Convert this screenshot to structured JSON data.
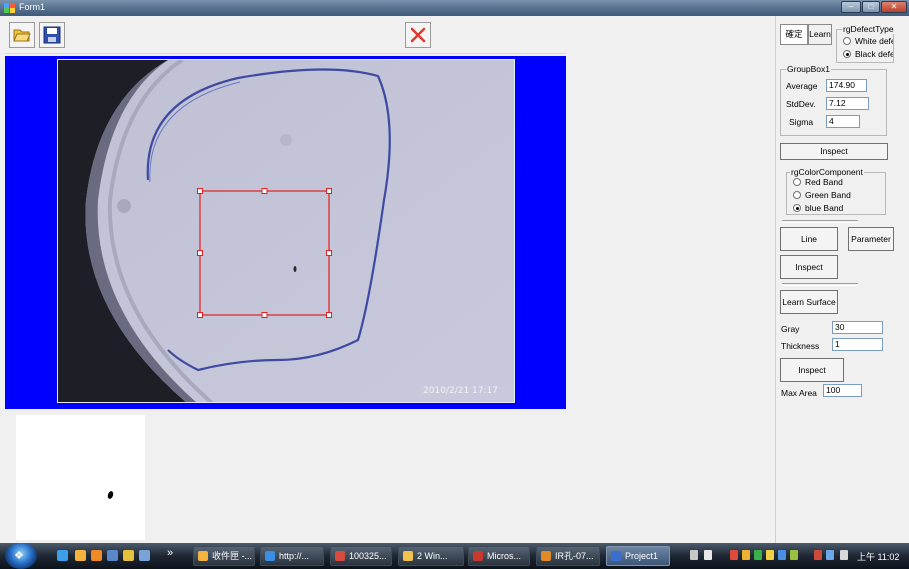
{
  "window": {
    "title": "Form1",
    "controls": [
      "–",
      "□",
      "✕"
    ]
  },
  "toolbar": {
    "open_icon": "folder-open-icon",
    "save_icon": "save-disk-icon",
    "close_icon": "red-x-icon"
  },
  "viewer": {
    "timestamp": "2010/2/21 17:17"
  },
  "panel": {
    "tab_confirm": "確定",
    "tab_learn": "Learn",
    "defect_type": {
      "title": "rgDefectType",
      "options": [
        "White defe",
        "Black defe"
      ],
      "selected": 1
    },
    "groupbox1": {
      "title": "GroupBox1",
      "average_label": "Average",
      "average_value": "174.90",
      "stddev_label": "StdDev.",
      "stddev_value": "7.12",
      "sigma_label": "Sigma",
      "sigma_value": "4"
    },
    "inspect_label_1": "Inspect",
    "color_component": {
      "title": "rgColorComponent",
      "options": [
        "Red Band",
        "Green Band",
        "blue Band"
      ],
      "selected": 2
    },
    "line_label": "Line",
    "parameter_label": "Parameter",
    "inspect_label_2": "Inspect",
    "learn_surface_label": "Learn Surface",
    "gray_label": "Gray",
    "gray_value": "30",
    "thickness_label": "Thickness",
    "thickness_value": "1",
    "inspect_label_3": "Inspect",
    "max_area_label": "Max Area",
    "max_area_value": "100"
  },
  "taskbar": {
    "quick_launch_more": "»",
    "tasks": [
      {
        "label": "收件匣 -...",
        "color": "#f3b33d"
      },
      {
        "label": "http://...",
        "color": "#3a8ee6"
      },
      {
        "label": "100325...",
        "color": "#d84b3c"
      },
      {
        "label": "2 Win...",
        "color": "#f0c24a"
      },
      {
        "label": "Micros...",
        "color": "#c8392b"
      },
      {
        "label": "IR孔-07...",
        "color": "#e08a2a"
      },
      {
        "label": "Project1",
        "color": "#3a6fd0"
      }
    ],
    "clock": "上午 11:02"
  },
  "colors": {
    "viewer_bg": "#0000ff",
    "roi": "#e02020",
    "accent_close": "#e03a2a"
  }
}
